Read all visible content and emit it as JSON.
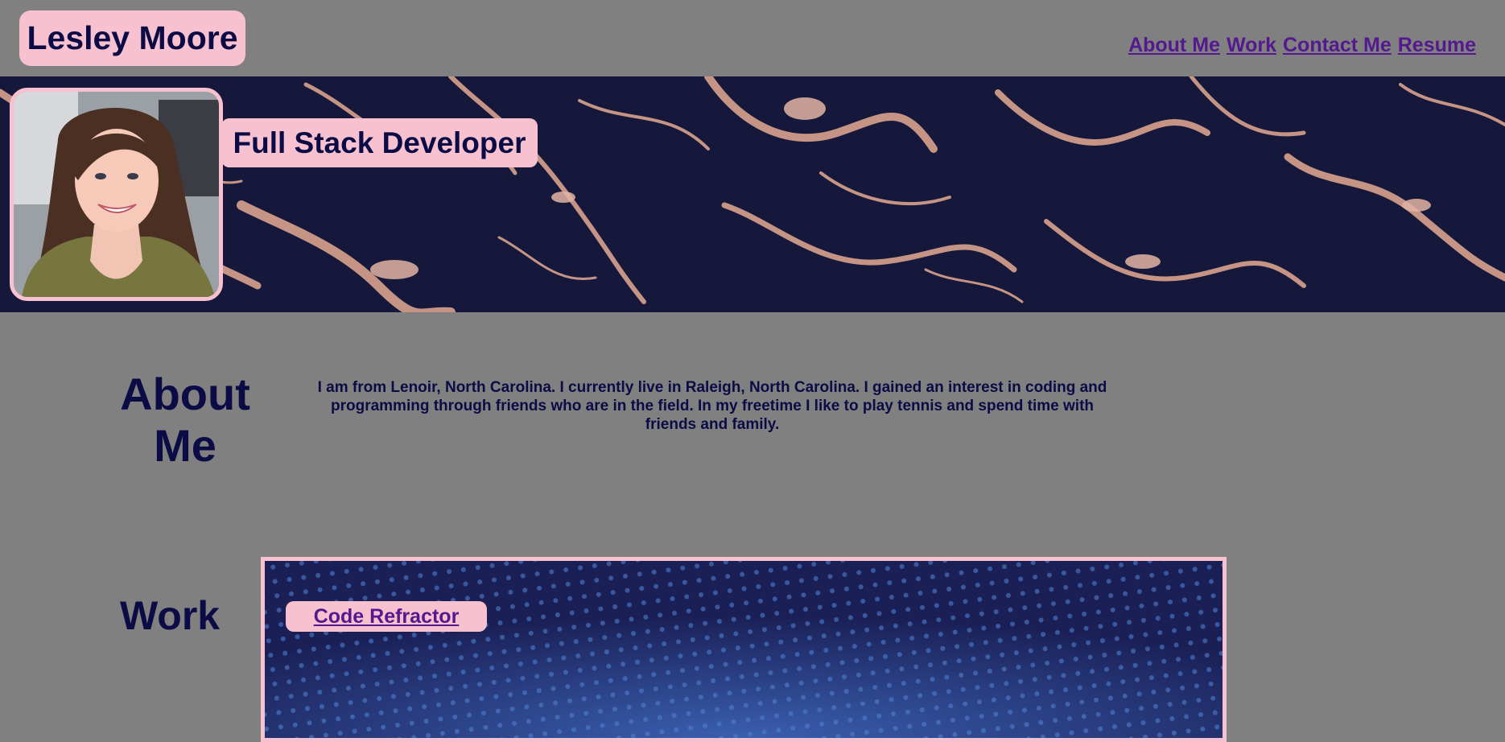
{
  "header": {
    "name": "Lesley Moore",
    "nav": [
      "About Me",
      "Work",
      "Contact Me",
      "Resume"
    ]
  },
  "hero": {
    "subtitle": "Full Stack Developer",
    "avatar_alt": "profile-photo"
  },
  "about": {
    "heading": "About Me",
    "text": "I am from Lenoir, North Carolina. I currently live in Raleigh, North Carolina. I gained an interest in coding and programming through friends who are in the field. In my freetime I like to play tennis and spend time with friends and family."
  },
  "work": {
    "heading": "Work",
    "projects": [
      {
        "label": "Code Refractor"
      }
    ]
  },
  "colors": {
    "background": "#808080",
    "pink": "#f8c1cf",
    "navy_text": "#0b0b45",
    "link": "#54198f",
    "hero_bg": "#15183a"
  }
}
